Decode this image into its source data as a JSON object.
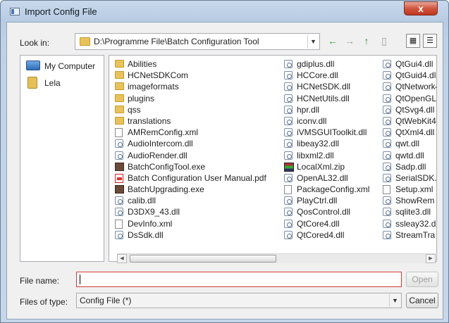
{
  "window": {
    "title": "Import Config File",
    "close_glyph": "x"
  },
  "toolbar": {
    "look_in_label": "Look in:",
    "path": "D:\\Programme File\\Batch Configuration Tool",
    "back_glyph": "←",
    "forward_glyph": "→",
    "up_glyph": "↑"
  },
  "sidebar": {
    "items": [
      {
        "label": "My Computer",
        "icon": "computer-icon"
      },
      {
        "label": "Lela",
        "icon": "user-folder-icon"
      }
    ]
  },
  "files": {
    "col1": [
      {
        "name": "Abilities",
        "icon": "folder-icon"
      },
      {
        "name": "HCNetSDKCom",
        "icon": "folder-icon"
      },
      {
        "name": "imageformats",
        "icon": "folder-icon"
      },
      {
        "name": "plugins",
        "icon": "folder-icon"
      },
      {
        "name": "qss",
        "icon": "folder-icon"
      },
      {
        "name": "translations",
        "icon": "folder-icon"
      },
      {
        "name": "AMRemConfig.xml",
        "icon": "doc-icon"
      },
      {
        "name": "AudioIntercom.dll",
        "icon": "dll-icon"
      },
      {
        "name": "AudioRender.dll",
        "icon": "dll-icon"
      },
      {
        "name": "BatchConfigTool.exe",
        "icon": "exe-icon"
      },
      {
        "name": "Batch Configuration User Manual.pdf",
        "icon": "pdf-icon"
      },
      {
        "name": "BatchUpgrading.exe",
        "icon": "exe-icon"
      },
      {
        "name": "calib.dll",
        "icon": "dll-icon"
      },
      {
        "name": "D3DX9_43.dll",
        "icon": "dll-icon"
      },
      {
        "name": "DevInfo.xml",
        "icon": "doc-icon"
      },
      {
        "name": "DsSdk.dll",
        "icon": "dll-icon"
      }
    ],
    "col2": [
      {
        "name": "gdiplus.dll",
        "icon": "dll-icon"
      },
      {
        "name": "HCCore.dll",
        "icon": "dll-icon"
      },
      {
        "name": "HCNetSDK.dll",
        "icon": "dll-icon"
      },
      {
        "name": "HCNetUtils.dll",
        "icon": "dll-icon"
      },
      {
        "name": "hpr.dll",
        "icon": "dll-icon"
      },
      {
        "name": "iconv.dll",
        "icon": "dll-icon"
      },
      {
        "name": "iVMSGUIToolkit.dll",
        "icon": "dll-icon"
      },
      {
        "name": "libeay32.dll",
        "icon": "dll-icon"
      },
      {
        "name": "libxml2.dll",
        "icon": "dll-icon"
      },
      {
        "name": "LocalXml.zip",
        "icon": "zip-icon"
      },
      {
        "name": "OpenAL32.dll",
        "icon": "dll-icon"
      },
      {
        "name": "PackageConfig.xml",
        "icon": "doc-icon"
      },
      {
        "name": "PlayCtrl.dll",
        "icon": "dll-icon"
      },
      {
        "name": "QosControl.dll",
        "icon": "dll-icon"
      },
      {
        "name": "QtCore4.dll",
        "icon": "dll-icon"
      },
      {
        "name": "QtCored4.dll",
        "icon": "dll-icon"
      }
    ],
    "col3": [
      {
        "name": "QtGui4.dll",
        "icon": "dll-icon"
      },
      {
        "name": "QtGuid4.dll",
        "icon": "dll-icon"
      },
      {
        "name": "QtNetwork4",
        "icon": "dll-icon"
      },
      {
        "name": "QtOpenGL4",
        "icon": "dll-icon"
      },
      {
        "name": "QtSvg4.dll",
        "icon": "dll-icon"
      },
      {
        "name": "QtWebKit4.",
        "icon": "dll-icon"
      },
      {
        "name": "QtXml4.dll",
        "icon": "dll-icon"
      },
      {
        "name": "qwt.dll",
        "icon": "dll-icon"
      },
      {
        "name": "qwtd.dll",
        "icon": "dll-icon"
      },
      {
        "name": "Sadp.dll",
        "icon": "dll-icon"
      },
      {
        "name": "SerialSDK.",
        "icon": "dll-icon"
      },
      {
        "name": "Setup.xml",
        "icon": "doc-icon"
      },
      {
        "name": "ShowRem",
        "icon": "dll-icon"
      },
      {
        "name": "sqlite3.dll",
        "icon": "dll-icon"
      },
      {
        "name": "ssleay32.d",
        "icon": "dll-icon"
      },
      {
        "name": "StreamTra",
        "icon": "dll-icon"
      }
    ]
  },
  "footer": {
    "file_name_label": "File name:",
    "file_name_value": "",
    "files_of_type_label": "Files of type:",
    "files_of_type_value": "Config File (*)",
    "open_label": "Open",
    "cancel_label": "Cancel"
  },
  "colors": {
    "accent": "#2e9a3c",
    "close": "#c0361f",
    "input_error_border": "#d23b3b"
  }
}
